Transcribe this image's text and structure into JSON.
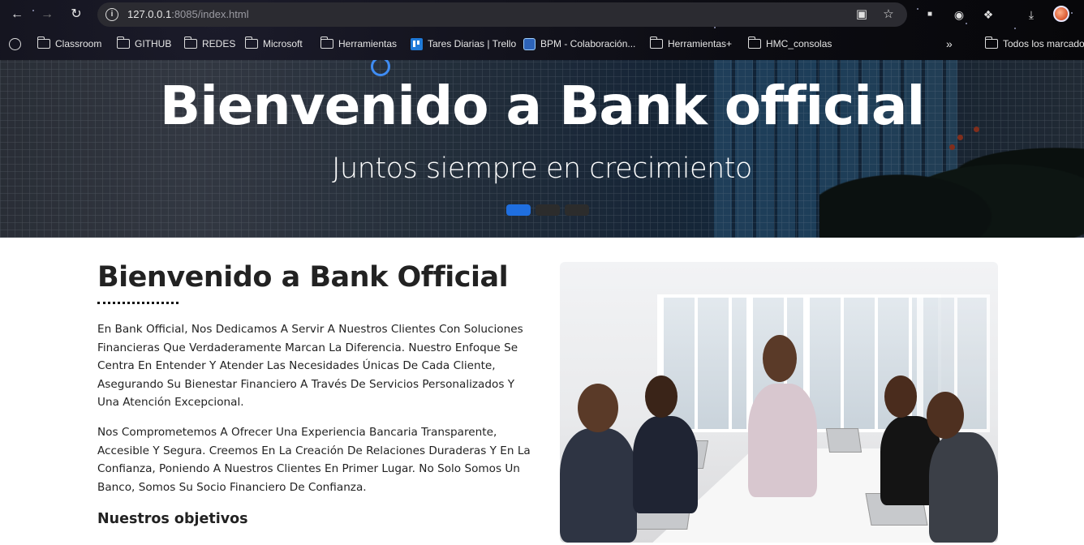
{
  "browser": {
    "url_host": "127.0.0.1",
    "url_rest": ":8085/index.html",
    "bookmarks": [
      {
        "label": "Classroom",
        "icon": "folder-icon"
      },
      {
        "label": "GITHUB",
        "icon": "folder-icon"
      },
      {
        "label": "REDES",
        "icon": "folder-icon"
      },
      {
        "label": "Microsoft",
        "icon": "folder-icon"
      },
      {
        "label": "Herramientas",
        "icon": "folder-icon"
      },
      {
        "label": "Tares Diarias | Trello",
        "icon": "trello-icon"
      },
      {
        "label": "BPM - Colaboración...",
        "icon": "bpm-icon"
      },
      {
        "label": "Herramientas+",
        "icon": "folder-icon"
      },
      {
        "label": "HMC_consolas",
        "icon": "folder-icon"
      }
    ],
    "all_bookmarks": "Todos los marcado"
  },
  "hero": {
    "title": "Bienvenido a Bank official",
    "subtitle": "Juntos siempre en crecimiento",
    "slides": 3,
    "active_slide": 1
  },
  "about": {
    "title": "Bienvenido a Bank Official",
    "p1": "En Bank Official, Nos Dedicamos A Servir A Nuestros Clientes Con Soluciones Financieras Que Verdaderamente Marcan La Diferencia. Nuestro Enfoque Se Centra En Entender Y Atender Las Necesidades Únicas De Cada Cliente, Asegurando Su Bienestar Financiero A Través De Servicios Personalizados Y Una Atención Excepcional.",
    "p2": "Nos Comprometemos A Ofrecer Una Experiencia Bancaria Transparente, Accesible Y Segura. Creemos En La Creación De Relaciones Duraderas Y En La Confianza, Poniendo A Nuestros Clientes En Primer Lugar. No Solo Somos Un Banco, Somos Su Socio Financiero De Confianza.",
    "objectives": "Nuestros objetivos"
  },
  "colors": {
    "accent": "#1f6fe0",
    "text": "#222222"
  }
}
